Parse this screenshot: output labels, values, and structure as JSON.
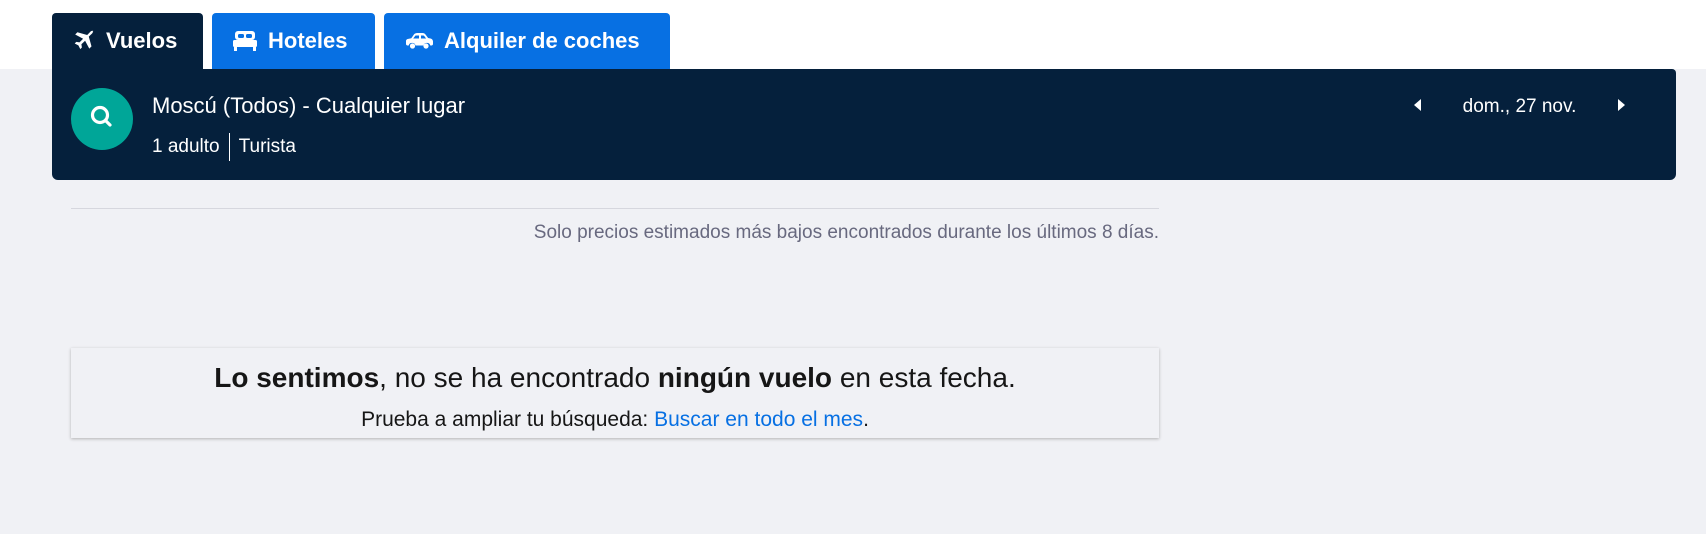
{
  "tabs": [
    {
      "label": "Vuelos",
      "icon": "plane-icon",
      "active": true
    },
    {
      "label": "Hoteles",
      "icon": "bed-icon",
      "active": false
    },
    {
      "label": "Alquiler de coches",
      "icon": "car-icon",
      "active": false
    }
  ],
  "search": {
    "route": "Moscú (Todos) - Cualquier lugar",
    "passengers": "1 adulto",
    "cabin_class": "Turista",
    "date": "dom., 27 nov."
  },
  "notice": "Solo precios estimados más bajos encontrados durante los últimos 8 días.",
  "empty_state": {
    "title_bold_1": "Lo sentimos",
    "title_text_1": ", no se ha encontrado ",
    "title_bold_2": "ningún vuelo",
    "title_text_2": " en esta fecha.",
    "hint_text": "Prueba a ampliar tu búsqueda: ",
    "hint_link": "Buscar en todo el mes",
    "hint_end": "."
  },
  "colors": {
    "navy": "#05203c",
    "blue": "#0770e3",
    "teal": "#00a698",
    "background": "#f0f1f5"
  }
}
